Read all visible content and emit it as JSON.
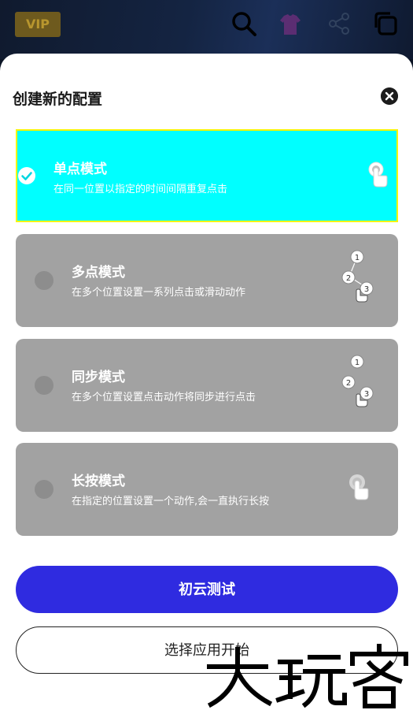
{
  "topbar": {
    "vip_label": "VIP",
    "icons": [
      "search-icon",
      "shirt-icon",
      "share-icon",
      "copy-icon"
    ]
  },
  "sheet": {
    "title": "创建新的配置",
    "modes": [
      {
        "title": "单点模式",
        "desc": "在同一位置以指定的时间间隔重复点击",
        "selected": true,
        "icon": "single-tap-icon"
      },
      {
        "title": "多点模式",
        "desc": "在多个位置设置一系列点击或滑动动作",
        "selected": false,
        "icon": "multi-tap-icon"
      },
      {
        "title": "同步模式",
        "desc": "在多个位置设置点击动作将同步进行点击",
        "selected": false,
        "icon": "sync-tap-icon"
      },
      {
        "title": "长按模式",
        "desc": "在指定的位置设置一个动作,会一直执行长按",
        "selected": false,
        "icon": "long-press-icon"
      }
    ],
    "illustration_numbers": [
      "1",
      "2",
      "3"
    ],
    "primary_button": "初云测试",
    "secondary_button": "选择应用开始"
  },
  "colors": {
    "selected_card": "#00ffff",
    "selected_border": "#f5f500",
    "card": "#a2a2a2",
    "primary_button": "#2f2be0"
  }
}
